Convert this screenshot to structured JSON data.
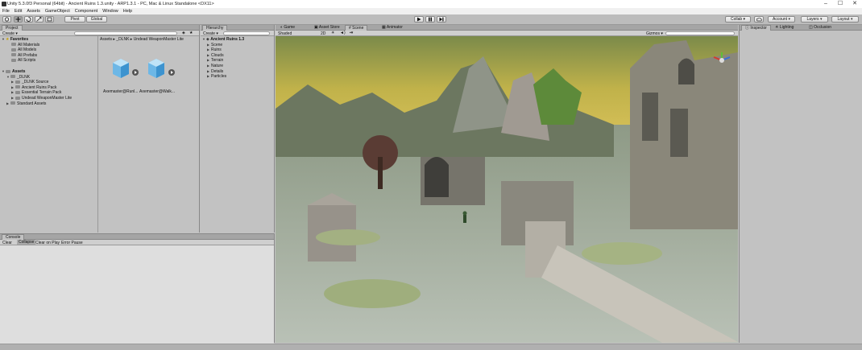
{
  "window": {
    "title": "Unity 5.3.0f3 Personal (64bit) - Ancient Ruins 1.3.unity - ARP1.3.1 - PC, Mac & Linux Standalone <DX11>",
    "controls": [
      "–",
      "☐",
      "✕"
    ]
  },
  "menu": [
    "File",
    "Edit",
    "Assets",
    "GameObject",
    "Component",
    "Window",
    "Help"
  ],
  "toolbar": {
    "pivot": "Pivot",
    "global": "Global",
    "collab": "Collab ▾",
    "account": "Account",
    "layers": "Layers",
    "layout": "Layout"
  },
  "project": {
    "tab": "Project",
    "create": "Create ▾",
    "breadcrumb": "Assets ▸ _DLNK ▸ Undead WeaponMaster Lite",
    "favorites_label": "Favorites",
    "favorites": [
      "All Materials",
      "All Models",
      "All Prefabs",
      "All Scripts"
    ],
    "assets_label": "Assets",
    "assets_tree": [
      {
        "label": "_DLNK",
        "indent": 1,
        "open": true
      },
      {
        "label": "_DLNK Source",
        "indent": 2
      },
      {
        "label": "Ancient Ruins Pack",
        "indent": 2
      },
      {
        "label": "Essential Terrain Pack",
        "indent": 2
      },
      {
        "label": "Undead WeaponMaster Lite",
        "indent": 2
      },
      {
        "label": "Standard Assets",
        "indent": 1
      }
    ],
    "files": [
      "Axemaster@Runl...",
      "Axemaster@Walk..."
    ]
  },
  "hierarchy": {
    "tab": "Hierarchy",
    "create": "Create ▾",
    "root": "Ancient Ruins 1.3",
    "children": [
      "Scene",
      "Ruins",
      "Clouds",
      "Terrain",
      "Nature",
      "Details",
      "Particles"
    ]
  },
  "center_tabs": {
    "game": "Game",
    "asset_store": "Asset Store",
    "scene": "Scene",
    "animator": "Animator"
  },
  "scene": {
    "shading": "Shaded",
    "mode_2d": "2D",
    "gizmos": "Gizmos ▾"
  },
  "console": {
    "tab": "Console",
    "buttons": [
      "Clear",
      "Collapse",
      "Clear on Play",
      "Error Pause"
    ]
  },
  "right_tabs": {
    "inspector": "Inspector",
    "lighting": "Lighting",
    "occlusion": "Occlusion"
  }
}
